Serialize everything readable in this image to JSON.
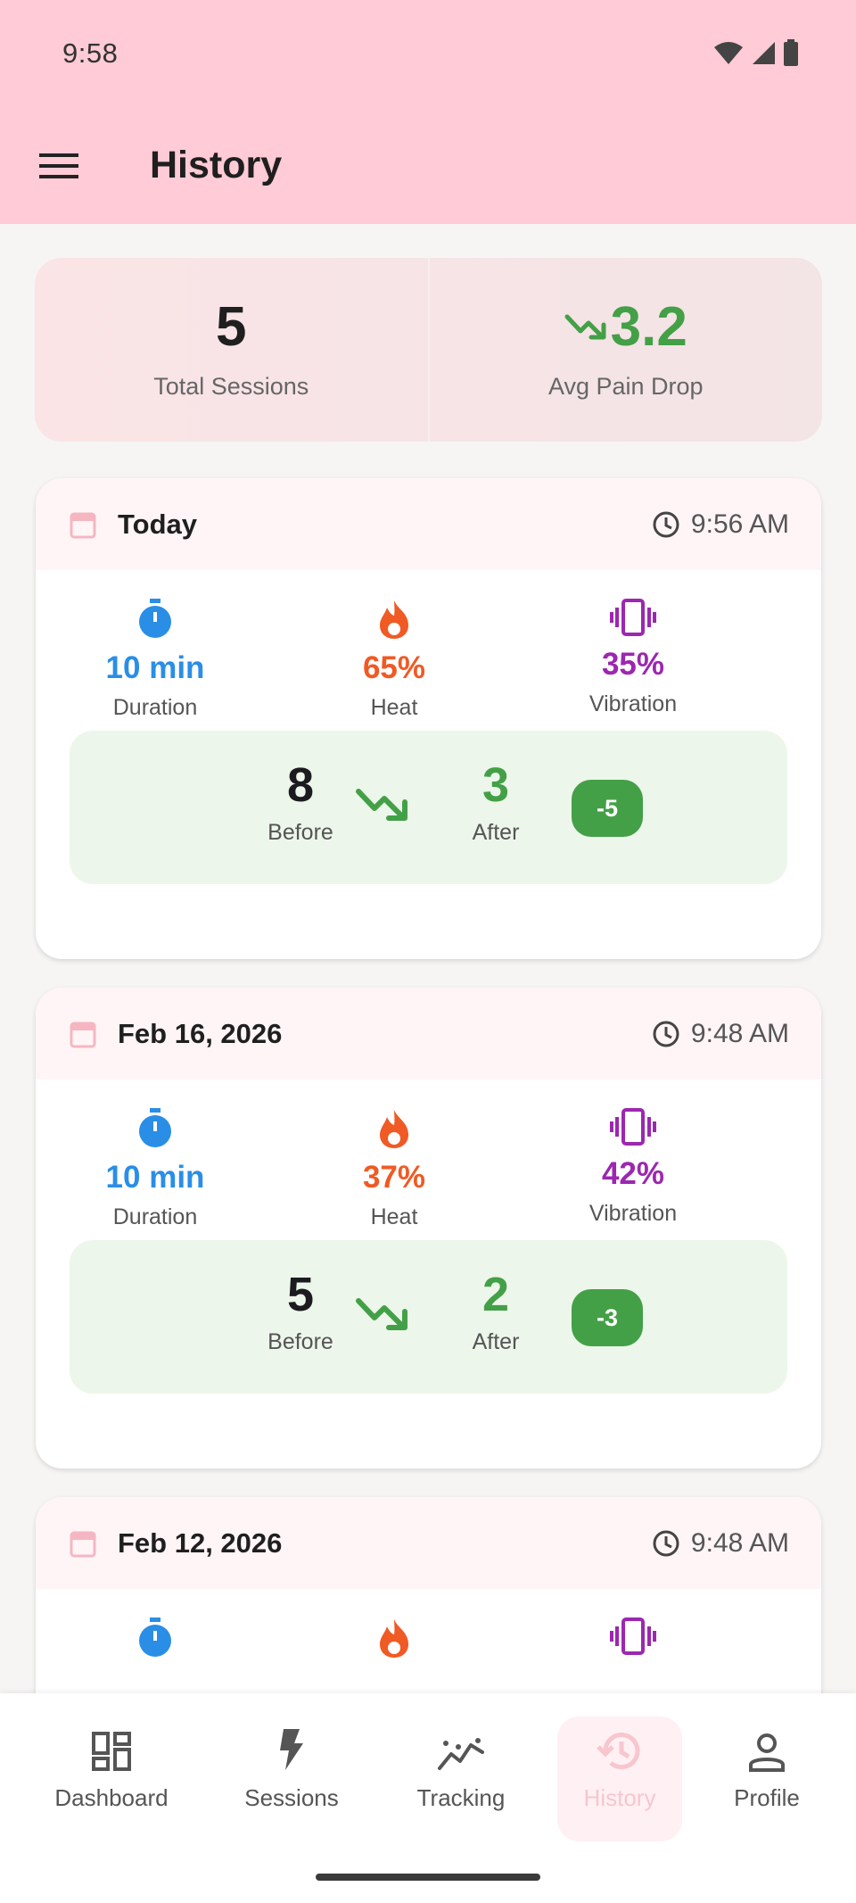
{
  "status_bar": {
    "time": "9:58"
  },
  "app_bar": {
    "title": "History"
  },
  "summary": {
    "total_sessions": "5",
    "total_sessions_label": "Total Sessions",
    "avg_pain_drop": "3.2",
    "avg_pain_drop_label": "Avg Pain Drop"
  },
  "sessions": [
    {
      "date": "Today",
      "time": "9:56 AM",
      "duration": "10 min",
      "duration_label": "Duration",
      "heat": "65%",
      "heat_label": "Heat",
      "vibration": "35%",
      "vibration_label": "Vibration",
      "before": "8",
      "before_label": "Before",
      "after": "3",
      "after_label": "After",
      "delta": "-5"
    },
    {
      "date": "Feb 16, 2026",
      "time": "9:48 AM",
      "duration": "10 min",
      "duration_label": "Duration",
      "heat": "37%",
      "heat_label": "Heat",
      "vibration": "42%",
      "vibration_label": "Vibration",
      "before": "5",
      "before_label": "Before",
      "after": "2",
      "after_label": "After",
      "delta": "-3"
    },
    {
      "date": "Feb 12, 2026",
      "time": "9:48 AM"
    }
  ],
  "nav": {
    "items": [
      {
        "label": "Dashboard",
        "icon": "dashboard-icon"
      },
      {
        "label": "Sessions",
        "icon": "bolt-icon"
      },
      {
        "label": "Tracking",
        "icon": "trend-icon"
      },
      {
        "label": "History",
        "icon": "history-icon",
        "active": true
      },
      {
        "label": "Profile",
        "icon": "person-icon"
      }
    ]
  },
  "colors": {
    "app_bar": "#ffcbd6",
    "accent_green": "#43a047",
    "blue": "#2a8ee6",
    "orange": "#f05a24",
    "purple": "#9c27b0"
  }
}
